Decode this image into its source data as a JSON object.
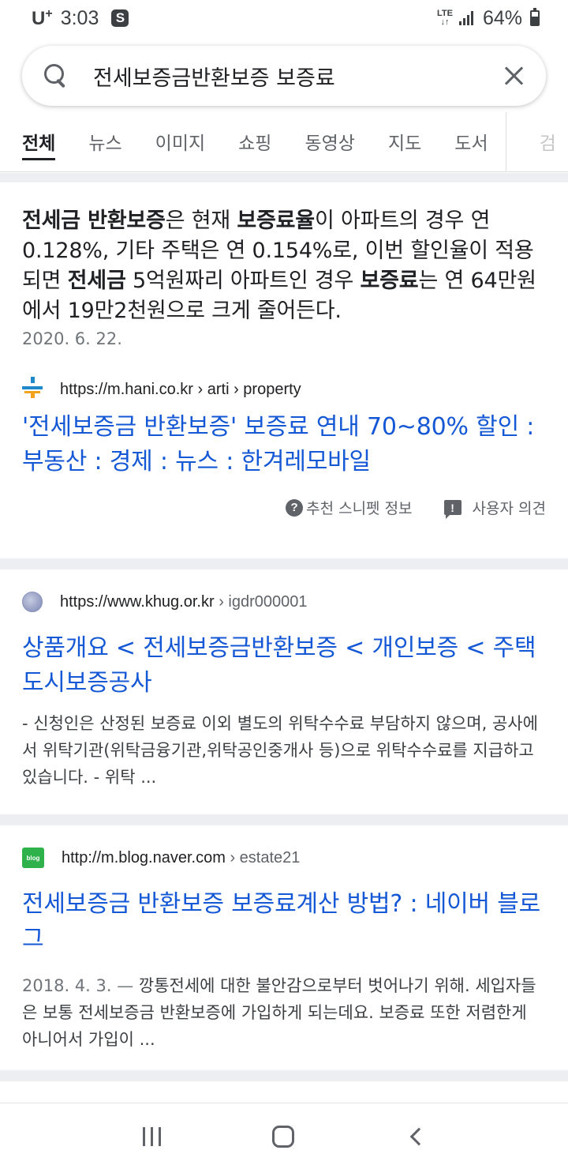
{
  "status_bar": {
    "carrier": "U",
    "carrier_sup": "+",
    "time": "3:03",
    "s_icon": "S",
    "network": "LTE",
    "battery": "64%"
  },
  "search": {
    "query": "전세보증금반환보증 보증료"
  },
  "tabs": [
    {
      "label": "전체",
      "active": true
    },
    {
      "label": "뉴스"
    },
    {
      "label": "이미지"
    },
    {
      "label": "쇼핑"
    },
    {
      "label": "동영상"
    },
    {
      "label": "지도"
    },
    {
      "label": "도서"
    },
    {
      "label": "검"
    }
  ],
  "featured_snippet": {
    "parts": [
      {
        "text": "전세금 반환보증",
        "bold": true
      },
      {
        "text": "은 현재 "
      },
      {
        "text": "보증료율",
        "bold": true
      },
      {
        "text": "이 아파트의 경우 연 0.128%, 기타 주택은 연 0.154%로, 이번 할인율이 적용되면 "
      },
      {
        "text": "전세금",
        "bold": true
      },
      {
        "text": " 5억원짜리 아파트인 경우 "
      },
      {
        "text": "보증료",
        "bold": true
      },
      {
        "text": "는 연 64만원에서 19만2천원으로 크게 줄어든다."
      }
    ],
    "date": "2020. 6. 22.",
    "url": "https://m.hani.co.kr",
    "crumbs": "› arti › property",
    "title": "'전세보증금 반환보증' 보증료 연내 70~80% 할인 : 부동산 : 경제 : 뉴스 : 한겨레모바일",
    "about_label": "추천 스니펫 정보",
    "feedback_label": "사용자 의견"
  },
  "results": [
    {
      "url": "https://www.khug.or.kr",
      "crumbs": "› igdr000001",
      "title": "상품개요 < 전세보증금반환보증 < 개인보증 < 주택도시보증공사",
      "date": "",
      "description": "- 신청인은 산정된 보증료 이외 별도의 위탁수수료 부담하지 않으며, 공사에서 위탁기관(위탁금융기관,위탁공인중개사 등)으로 위탁수수료를 지급하고 있습니다. - 위탁 ..."
    },
    {
      "url": "http://m.blog.naver.com",
      "crumbs": "› estate21",
      "title": "전세보증금 반환보증 보증료계산 방법? : 네이버 블로그",
      "date": "2018. 4. 3. —",
      "description": " 깡통전세에 대한 불안감으로부터 벗어나기 위해. 세입자들은 보통 전세보증금 반환보증에 가입하게 되는데요. 보증료 또한 저렴한게 아니어서 가입이 ..."
    }
  ],
  "icons": {
    "blog_favicon_text": "blog",
    "help": "?",
    "feedback": "!"
  },
  "colors": {
    "link": "#1558d6",
    "gap": "#eceef1"
  }
}
